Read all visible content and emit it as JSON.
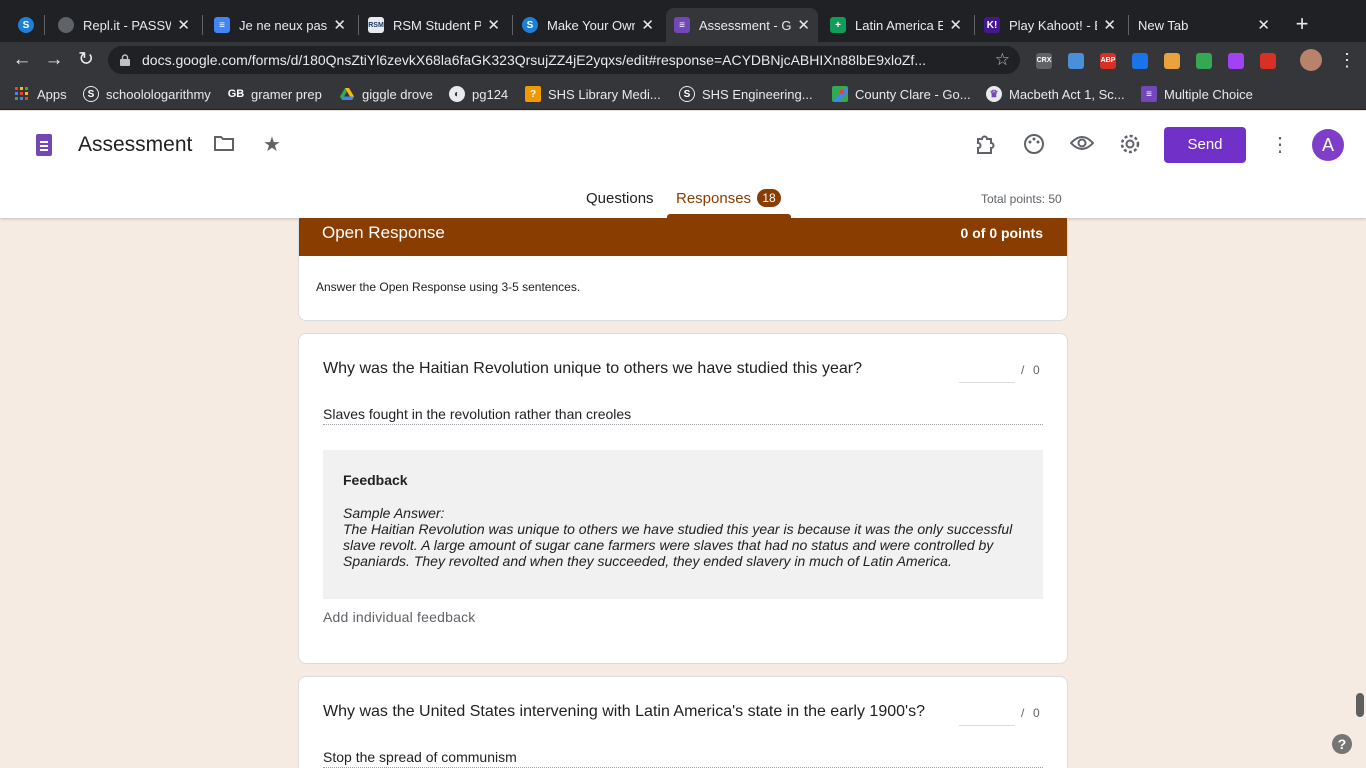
{
  "browser": {
    "tabs": [
      {
        "title": "Repl.it - PASSW",
        "icon": "replit-icon"
      },
      {
        "title": "Je ne neux pas",
        "icon": "google-docs-icon"
      },
      {
        "title": "RSM Student Po",
        "icon": "rsm-icon"
      },
      {
        "title": "Make Your Own",
        "icon": "schoology-icon"
      },
      {
        "title": "Assessment - G",
        "icon": "google-forms-icon"
      },
      {
        "title": "Latin America E",
        "icon": "google-sheets-icon"
      },
      {
        "title": "Play Kahoot! - E",
        "icon": "kahoot-icon"
      },
      {
        "title": "New Tab",
        "icon": ""
      }
    ],
    "first_tab_icon": "schoology-icon",
    "new_tab_label": "+",
    "url": "docs.google.com/forms/d/180QnsZtiYl6zevkX68la6faGK323QrsujZZ4jE2yqxs/edit#response=ACYDBNjcABHIXn88lbE9xloZf...",
    "bookmarks": [
      {
        "label": "Apps",
        "icon": "apps-grid-icon"
      },
      {
        "label": "schoolologarithmy",
        "icon": "schoology-icon"
      },
      {
        "label": "gramer prep",
        "icon": "gb-icon"
      },
      {
        "label": "giggle drove",
        "icon": "google-drive-icon"
      },
      {
        "label": "pg124",
        "icon": "globe-icon"
      },
      {
        "label": "SHS Library Medi...",
        "icon": "library-icon"
      },
      {
        "label": "SHS Engineering...",
        "icon": "schoology-icon"
      },
      {
        "label": "County Clare - Go...",
        "icon": "google-maps-icon"
      },
      {
        "label": "Macbeth Act 1, Sc...",
        "icon": "macbeth-icon"
      },
      {
        "label": "Multiple Choice",
        "icon": "google-forms-icon"
      }
    ],
    "extensions": [
      {
        "label": "CRX",
        "color": "#5f6368"
      },
      {
        "label": "",
        "color": "#4a90d9"
      },
      {
        "label": "ABP",
        "color": "#d93025"
      },
      {
        "label": "",
        "color": "#1a73e8"
      },
      {
        "label": "",
        "color": "#e8a33d"
      },
      {
        "label": "",
        "color": "#34a853"
      },
      {
        "label": "",
        "color": "#a142f4"
      },
      {
        "label": "",
        "color": "#d93025"
      }
    ]
  },
  "form": {
    "title": "Assessment",
    "send_label": "Send",
    "avatar_letter": "A",
    "tabs": {
      "questions": "Questions",
      "responses": "Responses"
    },
    "responses_count": "18",
    "total_points": "Total points: 50",
    "accent_color": "#8a3d00",
    "send_color": "#7131c8"
  },
  "section": {
    "title": "Open Response",
    "points": "0 of 0 points",
    "description": "Answer the Open Response using 3-5 sentences."
  },
  "questions": [
    {
      "text": "Why was the Haitian Revolution unique to others we have studied this year?",
      "score_slash": "/",
      "score_max": "0",
      "answer": "Slaves fought in the revolution rather than creoles",
      "feedback_heading": "Feedback",
      "feedback_label": "Sample Answer:",
      "feedback_body": "The Haitian Revolution was unique to others we have studied this year is because it was the only successful slave revolt. A large amount of sugar cane farmers were slaves that had no status and were controlled by Spaniards. They revolted and when they succeeded, they ended slavery in much of Latin America.",
      "add_feedback": "Add individual feedback"
    },
    {
      "text": "Why was the United States intervening with Latin America's state in the early 1900's?",
      "score_slash": "/",
      "score_max": "0",
      "answer": "Stop the spread of communism"
    }
  ],
  "help_label": "?"
}
